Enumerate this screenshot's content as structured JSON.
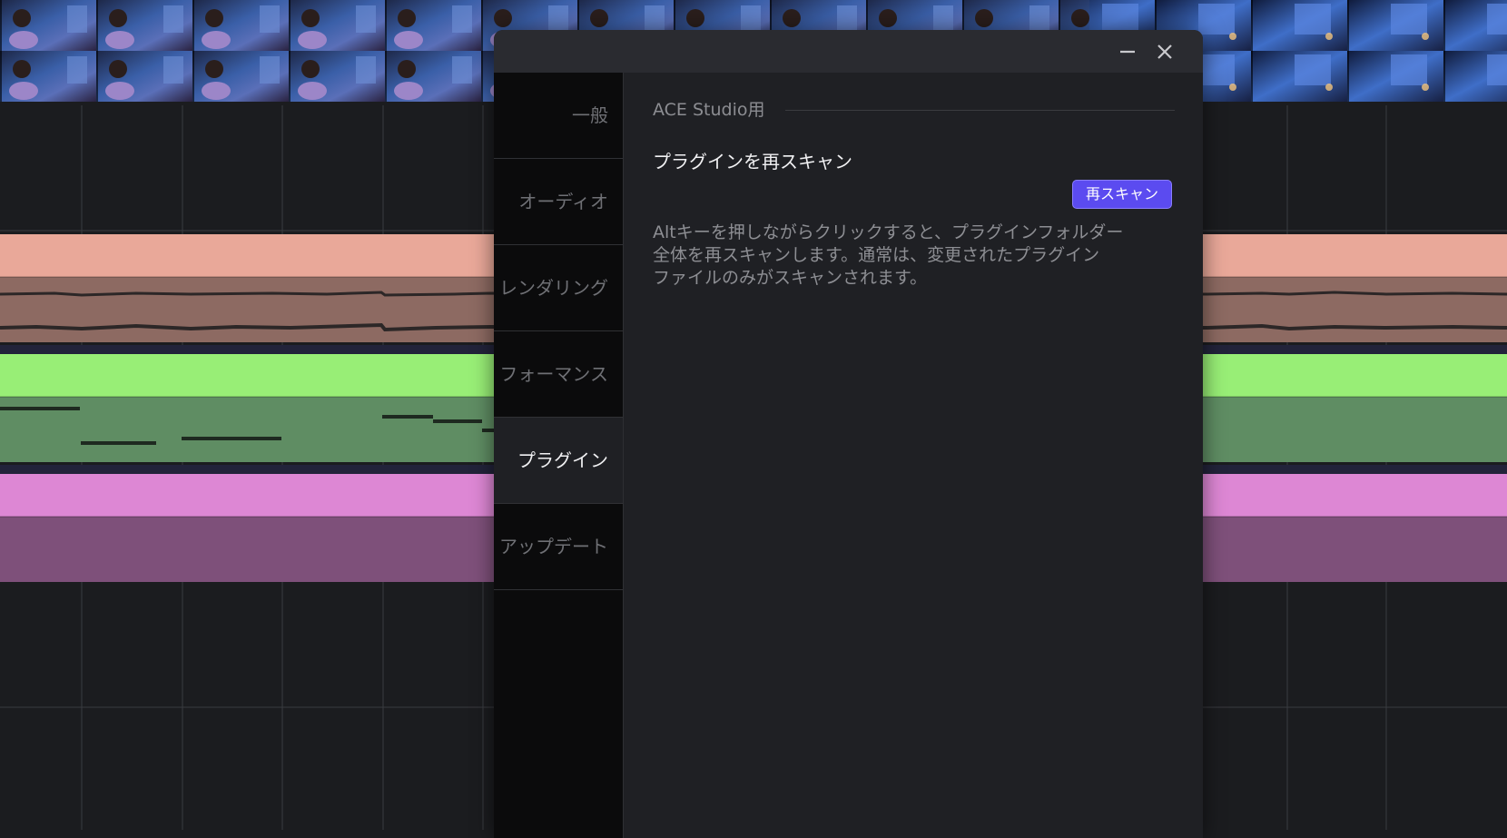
{
  "window": {
    "minimize_icon": "minimize-icon",
    "close_icon": "close-icon"
  },
  "nav": {
    "items": [
      {
        "label": "一般",
        "active": false
      },
      {
        "label": "オーディオ",
        "active": false
      },
      {
        "label": "レンダリング",
        "active": false
      },
      {
        "label": "フォーマンス",
        "active": false
      },
      {
        "label": "プラグイン",
        "active": true
      },
      {
        "label": "アップデート",
        "active": false
      }
    ]
  },
  "section": {
    "title": "ACE Studio用"
  },
  "setting": {
    "label": "プラグインを再スキャン",
    "button_label": "再スキャン",
    "description_lines": [
      "Altキーを押しながらクリックすると、プラグインフォルダー",
      "全体を再スキャンします。通常は、変更されたプラグイン",
      "ファイルのみがスキャンされます。"
    ]
  },
  "colors": {
    "accent": "#5b4bf0",
    "track_1": "#e9a899",
    "track_1_wave": "#8d6a62",
    "track_2": "#98ee76",
    "track_2_notes": "#5f8d63",
    "track_3": "#dd87d4",
    "track_3_body": "#7e507a",
    "dialog_bg": "#1f2024",
    "nav_bg": "#0b0b0c"
  }
}
